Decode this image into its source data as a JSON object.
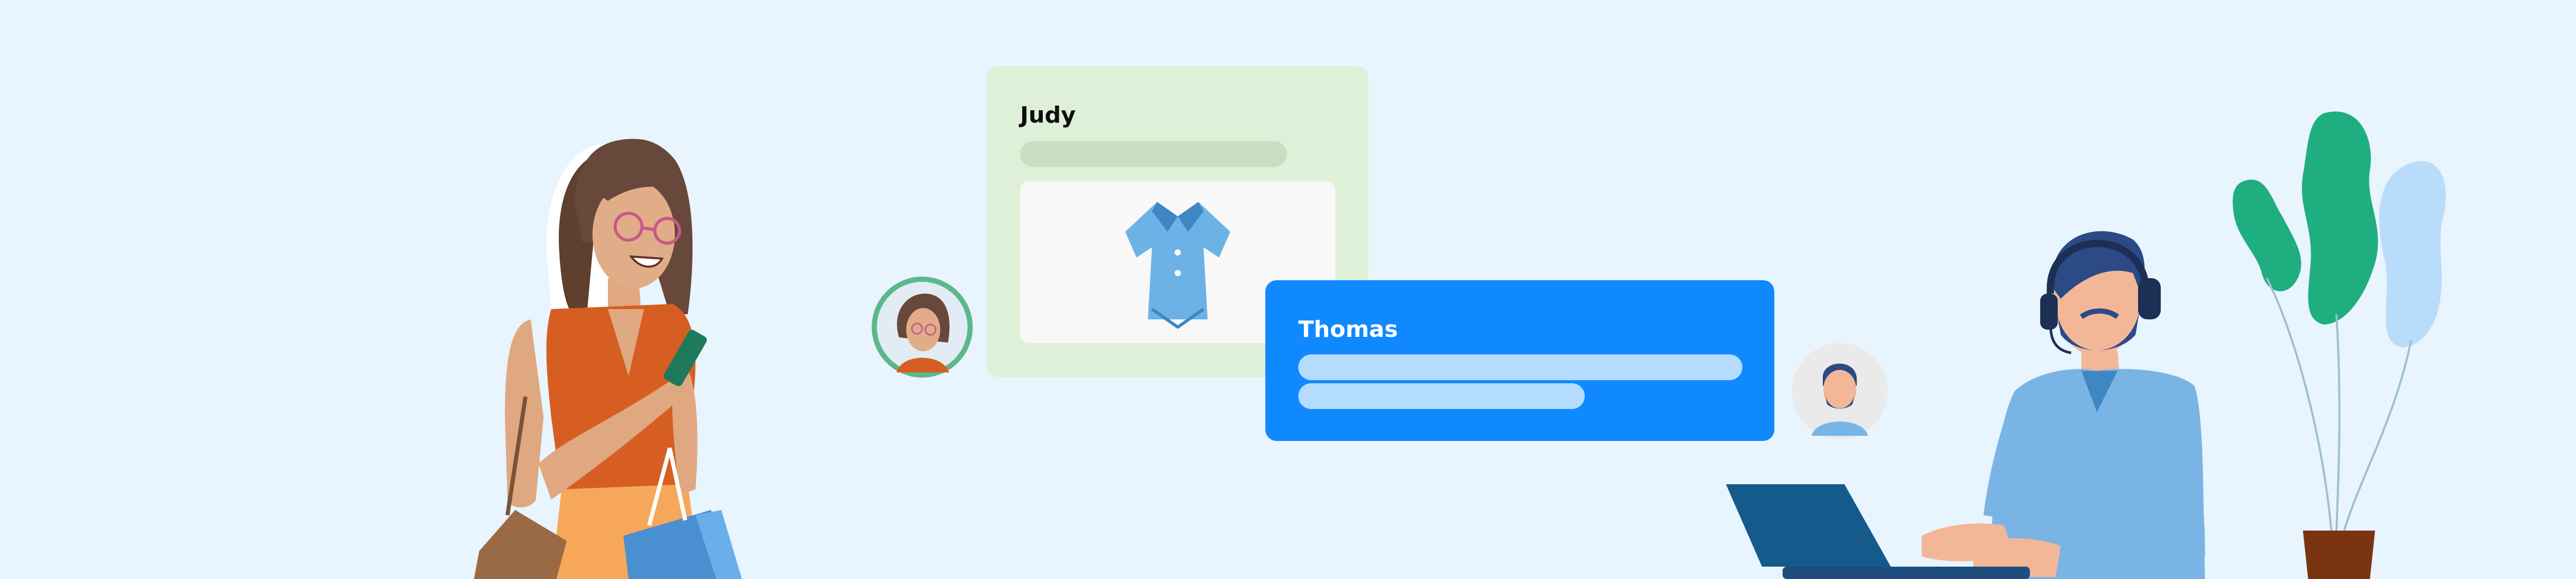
{
  "judy_card": {
    "name": "Judy",
    "bg_color": "#dff0d8",
    "image_icon": "shirt-icon"
  },
  "thomas_card": {
    "name": "Thomas",
    "bg_color": "#1089ff"
  },
  "judy_avatar": {
    "icon": "woman-avatar",
    "ring_color": "#5cb88a"
  },
  "thomas_avatar": {
    "icon": "man-avatar",
    "ring_color": "#e9e9e9"
  },
  "plant": {
    "icon": "plant-icon"
  },
  "colors": {
    "background": "#e8f4fe",
    "accent_blue": "#1089ff",
    "green_card": "#dff0d8"
  }
}
